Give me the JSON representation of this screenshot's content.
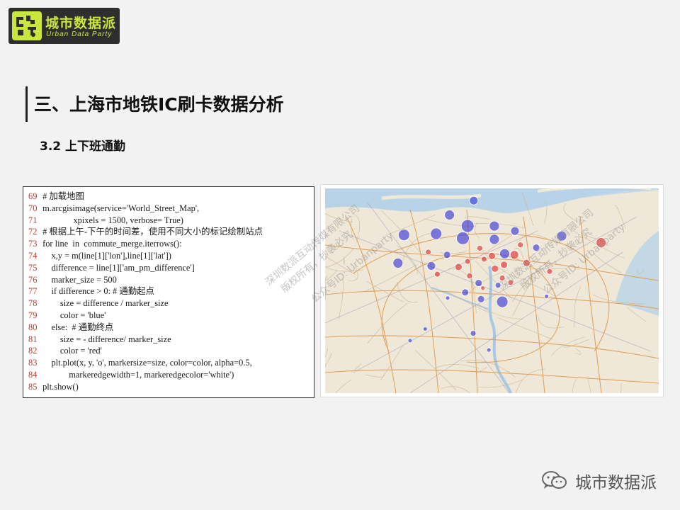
{
  "logo": {
    "name_cn": "城市数据派",
    "name_en": "Urban Data Party",
    "accent_color": "#c9e63c"
  },
  "page_title": "三、上海市地铁IC刷卡数据分析",
  "subtitle": "3.2  上下班通勤",
  "code": {
    "lines": [
      {
        "num": "69",
        "text": " # 加载地图"
      },
      {
        "num": "70",
        "text": " m.arcgisimage(service='World_Street_Map',"
      },
      {
        "num": "71",
        "text": "               xpixels = 1500, verbose= True)"
      },
      {
        "num": "72",
        "text": " # 根据上午-下午的时间差，使用不同大小的标记绘制站点"
      },
      {
        "num": "73",
        "text": " for line  in  commute_merge.iterrows():"
      },
      {
        "num": "74",
        "text": "     x,y = m(line[1]['lon'],line[1]['lat'])"
      },
      {
        "num": "75",
        "text": "     difference = line[1]['am_pm_difference']"
      },
      {
        "num": "76",
        "text": "     marker_size = 500"
      },
      {
        "num": "77",
        "text": "     if difference > 0: # 通勤起点"
      },
      {
        "num": "78",
        "text": "         size = difference / marker_size"
      },
      {
        "num": "79",
        "text": "         color = 'blue'"
      },
      {
        "num": "80",
        "text": "     else:  # 通勤终点"
      },
      {
        "num": "81",
        "text": "         size = - difference/ marker_size"
      },
      {
        "num": "82",
        "text": "         color = 'red'"
      },
      {
        "num": "83",
        "text": "     plt.plot(x, y, 'o', markersize=size, color=color, alpha=0.5,"
      },
      {
        "num": "84",
        "text": "             markeredgewidth=1, markeredgecolor='white')"
      },
      {
        "num": "85",
        "text": " plt.show()"
      }
    ]
  },
  "map": {
    "icon": "map-image",
    "colors": {
      "start": "#3b3bd9",
      "end": "#e03030"
    },
    "markers": [
      {
        "lon": 121.545,
        "lat": 31.398,
        "r": 6,
        "type": "start"
      },
      {
        "lon": 121.505,
        "lat": 31.372,
        "r": 7,
        "type": "start"
      },
      {
        "lon": 121.535,
        "lat": 31.352,
        "r": 9,
        "type": "start"
      },
      {
        "lon": 121.579,
        "lat": 31.352,
        "r": 7,
        "type": "start"
      },
      {
        "lon": 121.613,
        "lat": 31.343,
        "r": 6,
        "type": "start"
      },
      {
        "lon": 121.483,
        "lat": 31.338,
        "r": 8,
        "type": "start"
      },
      {
        "lon": 121.43,
        "lat": 31.336,
        "r": 8,
        "type": "start"
      },
      {
        "lon": 121.579,
        "lat": 31.328,
        "r": 7,
        "type": "start"
      },
      {
        "lon": 121.527,
        "lat": 31.33,
        "r": 9,
        "type": "start"
      },
      {
        "lon": 121.69,
        "lat": 31.334,
        "r": 7,
        "type": "start"
      },
      {
        "lon": 121.648,
        "lat": 31.313,
        "r": 5,
        "type": "start"
      },
      {
        "lon": 121.596,
        "lat": 31.302,
        "r": 7,
        "type": "start"
      },
      {
        "lon": 121.501,
        "lat": 31.3,
        "r": 5,
        "type": "start"
      },
      {
        "lon": 121.42,
        "lat": 31.285,
        "r": 7,
        "type": "start"
      },
      {
        "lon": 121.475,
        "lat": 31.28,
        "r": 6,
        "type": "start"
      },
      {
        "lon": 121.553,
        "lat": 31.249,
        "r": 5,
        "type": "start"
      },
      {
        "lon": 121.592,
        "lat": 31.215,
        "r": 8,
        "type": "start"
      },
      {
        "lon": 121.557,
        "lat": 31.22,
        "r": 5,
        "type": "start"
      },
      {
        "lon": 121.531,
        "lat": 31.232,
        "r": 5,
        "type": "start"
      },
      {
        "lon": 121.544,
        "lat": 31.158,
        "r": 4,
        "type": "start"
      },
      {
        "lon": 121.665,
        "lat": 31.225,
        "r": 3,
        "type": "start"
      },
      {
        "lon": 121.465,
        "lat": 31.166,
        "r": 3,
        "type": "start"
      },
      {
        "lon": 121.44,
        "lat": 31.145,
        "r": 3,
        "type": "start"
      },
      {
        "lon": 121.57,
        "lat": 31.128,
        "r": 3,
        "type": "start"
      },
      {
        "lon": 121.585,
        "lat": 31.245,
        "r": 4,
        "type": "start"
      },
      {
        "lon": 121.502,
        "lat": 31.222,
        "r": 3,
        "type": "start"
      },
      {
        "lon": 121.612,
        "lat": 31.3,
        "r": 6,
        "type": "end"
      },
      {
        "lon": 121.632,
        "lat": 31.285,
        "r": 5,
        "type": "end"
      },
      {
        "lon": 121.575,
        "lat": 31.298,
        "r": 5,
        "type": "end"
      },
      {
        "lon": 121.555,
        "lat": 31.312,
        "r": 4,
        "type": "end"
      },
      {
        "lon": 121.58,
        "lat": 31.275,
        "r": 5,
        "type": "end"
      },
      {
        "lon": 121.52,
        "lat": 31.278,
        "r": 5,
        "type": "end"
      },
      {
        "lon": 121.592,
        "lat": 31.258,
        "r": 4,
        "type": "end"
      },
      {
        "lon": 121.606,
        "lat": 31.25,
        "r": 4,
        "type": "end"
      },
      {
        "lon": 121.538,
        "lat": 31.262,
        "r": 4,
        "type": "end"
      },
      {
        "lon": 121.622,
        "lat": 31.318,
        "r": 4,
        "type": "end"
      },
      {
        "lon": 121.755,
        "lat": 31.322,
        "r": 7,
        "type": "end"
      },
      {
        "lon": 121.47,
        "lat": 31.305,
        "r": 4,
        "type": "end"
      },
      {
        "lon": 121.485,
        "lat": 31.265,
        "r": 4,
        "type": "end"
      },
      {
        "lon": 121.67,
        "lat": 31.27,
        "r": 4,
        "type": "end"
      },
      {
        "lon": 121.56,
        "lat": 31.24,
        "r": 3,
        "type": "end"
      },
      {
        "lon": 121.595,
        "lat": 31.282,
        "r": 5,
        "type": "end"
      },
      {
        "lon": 121.535,
        "lat": 31.288,
        "r": 4,
        "type": "end"
      },
      {
        "lon": 121.562,
        "lat": 31.292,
        "r": 4,
        "type": "end"
      }
    ]
  },
  "watermarks": {
    "line1": "深圳数派互动传媒有限公司",
    "line2": "版权所有，抄袭必究",
    "line3": "公众号ID: Urbanparty"
  },
  "brand": {
    "icon": "wechat-icon",
    "name": "城市数据派"
  }
}
